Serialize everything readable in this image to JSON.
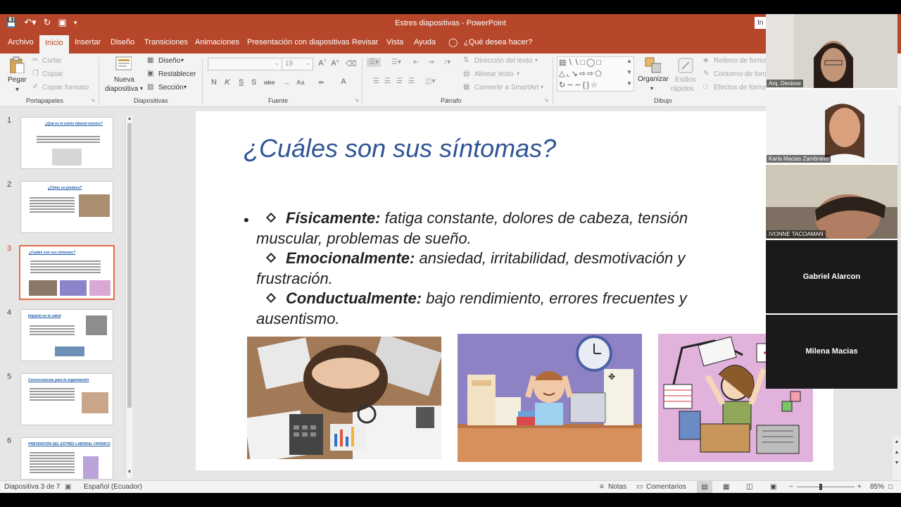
{
  "window": {
    "title": "Estres diapositivas  -  PowerPoint",
    "top_right_label": "In"
  },
  "quick_access": [
    "save-icon",
    "undo-icon",
    "redo-icon",
    "start-slideshow-icon",
    "customize-qat-icon"
  ],
  "tabs": [
    {
      "label": "Archivo",
      "active": false
    },
    {
      "label": "Inicio",
      "active": true
    },
    {
      "label": "Insertar",
      "active": false
    },
    {
      "label": "Diseño",
      "active": false
    },
    {
      "label": "Transiciones",
      "active": false
    },
    {
      "label": "Animaciones",
      "active": false
    },
    {
      "label": "Presentación con diapositivas",
      "active": false
    },
    {
      "label": "Revisar",
      "active": false
    },
    {
      "label": "Vista",
      "active": false
    },
    {
      "label": "Ayuda",
      "active": false
    }
  ],
  "tell_me": "¿Qué desea hacer?",
  "ribbon": {
    "clipboard": {
      "paste": "Pegar",
      "cut": "Cortar",
      "copy": "Copiar",
      "format_painter": "Copiar formato",
      "group": "Portapapeles"
    },
    "slides": {
      "new_slide_1": "Nueva",
      "new_slide_2": "diapositiva",
      "layout": "Diseño",
      "reset": "Restablecer",
      "section": "Sección",
      "group": "Diapositivas"
    },
    "font": {
      "font_size": "19",
      "buttons": [
        "N",
        "K",
        "S",
        "S",
        "abc",
        "Aa"
      ],
      "group": "Fuente"
    },
    "paragraph": {
      "text_direction": "Dirección del texto",
      "align_text": "Alinear texto",
      "smartart": "Convertir a SmartArt",
      "group": "Párrafo"
    },
    "drawing": {
      "arrange": "Organizar",
      "quick_styles_1": "Estilos",
      "quick_styles_2": "rápidos",
      "fill": "Relleno de forma",
      "outline": "Contorno de forma",
      "effects": "Efectos de forma",
      "group": "Dibujo"
    }
  },
  "thumbnails": [
    {
      "num": "1",
      "title": "¿Qué es el estrés laboral crónico?",
      "selected": false
    },
    {
      "num": "2",
      "title": "¿Cómo se produce?",
      "selected": false
    },
    {
      "num": "3",
      "title": "¿Cuáles son sus síntomas?",
      "selected": true
    },
    {
      "num": "4",
      "title": "Impacto en la salud",
      "selected": false
    },
    {
      "num": "5",
      "title": "Consecuencias para la organización",
      "selected": false
    },
    {
      "num": "6",
      "title": "PREVENCIÓN DEL ESTRÉS LABORAL CRÓNICO",
      "selected": false
    }
  ],
  "slide": {
    "title": "¿Cuáles son sus síntomas?",
    "items": [
      {
        "label": "Físicamente:",
        "text": " fatiga constante, dolores de cabeza, tensión muscular, problemas de sueño."
      },
      {
        "label": "Emocionalmente:",
        "text": " ansiedad, irritabilidad, desmotivación y frustración."
      },
      {
        "label": "Conductualmente:",
        "text": " bajo rendimiento, errores frecuentes y ausentismo."
      }
    ]
  },
  "status": {
    "slide_info": "Diapositiva 3 de 7",
    "language": "Español (Ecuador)",
    "notes": "Notas",
    "comments": "Comentarios",
    "zoom_minus": "−",
    "zoom_plus": "+",
    "zoom": "85%"
  },
  "participants": [
    {
      "name": "Arq. Denisse",
      "camera": true
    },
    {
      "name": "Karla Macias Zambrano",
      "camera": true
    },
    {
      "name": "IVONNE TACOAMAN",
      "camera": true
    },
    {
      "name": "Gabriel Alarcon",
      "camera": false
    },
    {
      "name": "Milena Macias",
      "camera": false
    }
  ],
  "colors": {
    "accent": "#b7472a",
    "title_blue": "#2f5496",
    "selected_thumb": "#e36c4c"
  }
}
